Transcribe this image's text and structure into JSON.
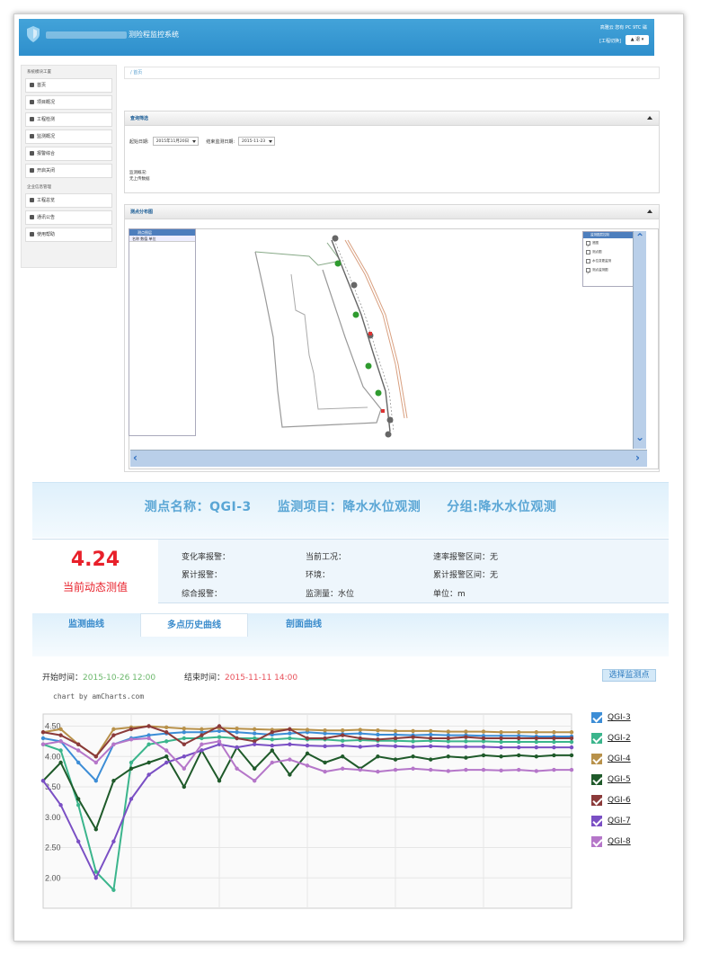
{
  "header": {
    "app_title": "测险程监控系统",
    "user_info": "高雅云 您有 PC 9TC 磁",
    "worktable": "[工程切换]",
    "user_btn": "▲ 退 ▾"
  },
  "sidebar": {
    "group1": "系统模块工置",
    "items1": [
      "首页",
      "项目概况",
      "工程检测",
      "监测概况",
      "报警综合",
      "开启关闭"
    ],
    "group2": "企业信息管理",
    "items2": [
      "工程总览",
      "通讯公告",
      "使用帮助"
    ]
  },
  "breadcrumb": "/ 首页",
  "query_panel": {
    "title": "查询筛选",
    "label_start": "起始日期:",
    "start_value": "2015年11月20日",
    "label_end": "结束监测日期:",
    "end_value": "2015-11-23",
    "note_label": "监测概况:",
    "note_value": "无上传数据"
  },
  "map_panel": {
    "title": "测点分布图",
    "legend_title": "测点图层",
    "legend_cols": "名称  数值  单位",
    "layer_title": "监测图层控制",
    "layers": [
      {
        "label": "底图",
        "checked": true
      },
      {
        "label": "测点图",
        "checked": false
      },
      {
        "label": "水位变更监测",
        "checked": false
      },
      {
        "label": "测点监测图",
        "checked": true
      }
    ]
  },
  "point_title": "测点名称：QGI-3　　监测项目：降水水位观测　　分组:降水水位观测",
  "current_value": "4.24",
  "current_value_label": "当前动态测值",
  "info": {
    "col1": [
      "变化率报警：",
      "累计报警：",
      "综合报警："
    ],
    "col2": [
      "当前工况：",
      "环境：",
      "监测量：水位"
    ],
    "col3": [
      "速率报警区间：无",
      "累计报警区间：无",
      "单位：m"
    ]
  },
  "tabs": [
    "监测曲线",
    "多点历史曲线",
    "剖面曲线"
  ],
  "active_tab": 1,
  "time": {
    "start_label": "开始时间：",
    "start_value": "2015-10-26 12:00",
    "end_label": "结束时间：",
    "end_value": "2015-11-11 14:00"
  },
  "pick_button": "选择监测点",
  "chart_credit": "chart by amCharts.com",
  "chart_data": {
    "type": "line",
    "title": "",
    "xlabel": "",
    "ylabel": "",
    "ylim": [
      1.5,
      4.7
    ],
    "y_ticks": [
      "4.50",
      "4.00",
      "3.50",
      "3.00",
      "2.50",
      "2.00"
    ],
    "x": [
      0,
      1,
      2,
      3,
      4,
      5,
      6,
      7,
      8,
      9,
      10,
      11,
      12,
      13,
      14,
      15,
      16,
      17,
      18,
      19,
      20,
      21,
      22,
      23,
      24,
      25,
      26,
      27,
      28,
      29,
      30
    ],
    "series": [
      {
        "name": "QGI-3",
        "color": "#3c8dd6",
        "values": [
          4.3,
          4.25,
          3.9,
          3.6,
          4.2,
          4.3,
          4.35,
          4.38,
          4.4,
          4.4,
          4.42,
          4.4,
          4.38,
          4.36,
          4.38,
          4.4,
          4.38,
          4.37,
          4.38,
          4.36,
          4.36,
          4.35,
          4.36,
          4.35,
          4.35,
          4.34,
          4.34,
          4.34,
          4.33,
          4.33,
          4.33
        ]
      },
      {
        "name": "QGI-2",
        "color": "#3bb58c",
        "values": [
          4.2,
          4.1,
          3.2,
          2.1,
          1.8,
          3.9,
          4.2,
          4.25,
          4.3,
          4.3,
          4.32,
          4.3,
          4.3,
          4.28,
          4.3,
          4.28,
          4.28,
          4.26,
          4.27,
          4.26,
          4.26,
          4.25,
          4.26,
          4.25,
          4.25,
          4.25,
          4.24,
          4.24,
          4.24,
          4.24,
          4.24
        ]
      },
      {
        "name": "QGI-4",
        "color": "#b8914a",
        "values": [
          4.4,
          4.45,
          4.2,
          4.0,
          4.45,
          4.48,
          4.5,
          4.48,
          4.46,
          4.45,
          4.47,
          4.46,
          4.45,
          4.44,
          4.45,
          4.44,
          4.43,
          4.43,
          4.44,
          4.43,
          4.42,
          4.42,
          4.42,
          4.41,
          4.41,
          4.41,
          4.4,
          4.4,
          4.4,
          4.4,
          4.4
        ]
      },
      {
        "name": "QGI-5",
        "color": "#1f5a2a",
        "values": [
          3.6,
          3.9,
          3.3,
          2.8,
          3.6,
          3.8,
          3.9,
          4.0,
          3.5,
          4.1,
          3.6,
          4.15,
          3.8,
          4.1,
          3.7,
          4.05,
          3.9,
          4.0,
          3.8,
          4.0,
          3.95,
          4.0,
          3.95,
          4.0,
          3.98,
          4.02,
          4.0,
          4.02,
          4.0,
          4.02,
          4.02
        ]
      },
      {
        "name": "QGI-6",
        "color": "#8b3a3a",
        "values": [
          4.4,
          4.35,
          4.2,
          4.0,
          4.35,
          4.45,
          4.5,
          4.4,
          4.2,
          4.35,
          4.5,
          4.3,
          4.25,
          4.4,
          4.45,
          4.3,
          4.3,
          4.35,
          4.3,
          4.28,
          4.3,
          4.32,
          4.3,
          4.3,
          4.32,
          4.3,
          4.3,
          4.3,
          4.3,
          4.3,
          4.3
        ]
      },
      {
        "name": "QGI-7",
        "color": "#7a4fc4",
        "values": [
          3.6,
          3.2,
          2.6,
          2.0,
          2.6,
          3.3,
          3.7,
          3.9,
          4.0,
          4.1,
          4.2,
          4.15,
          4.2,
          4.18,
          4.2,
          4.18,
          4.17,
          4.18,
          4.16,
          4.18,
          4.17,
          4.16,
          4.17,
          4.16,
          4.16,
          4.16,
          4.15,
          4.15,
          4.15,
          4.15,
          4.15
        ]
      },
      {
        "name": "QGI-8",
        "color": "#b576c9",
        "values": [
          4.2,
          4.25,
          4.1,
          3.9,
          4.2,
          4.28,
          4.3,
          4.1,
          3.8,
          4.2,
          4.25,
          3.8,
          3.6,
          3.9,
          3.95,
          3.85,
          3.75,
          3.8,
          3.78,
          3.75,
          3.78,
          3.8,
          3.78,
          3.76,
          3.78,
          3.78,
          3.77,
          3.78,
          3.76,
          3.78,
          3.78
        ]
      }
    ]
  }
}
